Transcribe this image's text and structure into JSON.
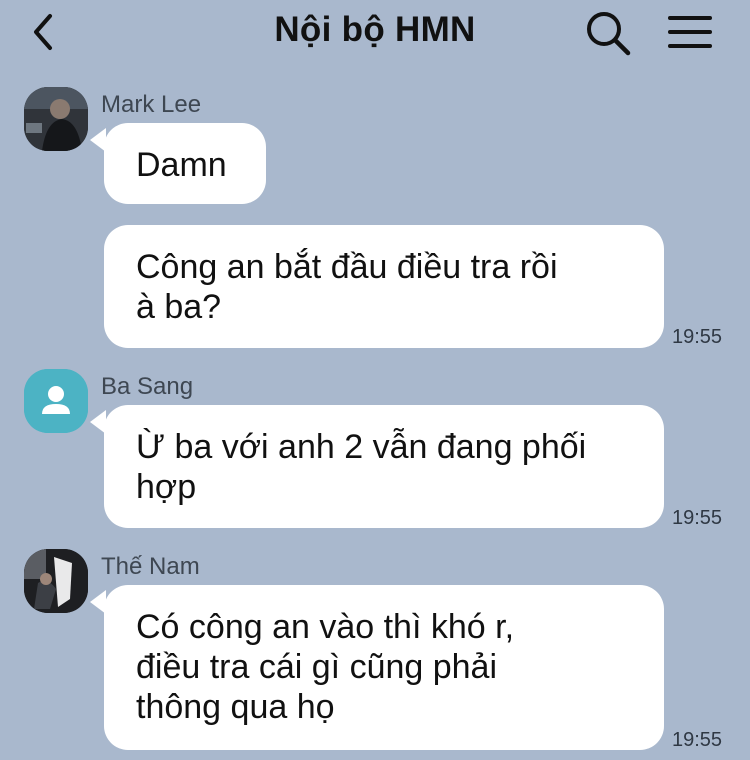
{
  "header": {
    "title": "Nội bộ HMN",
    "back_icon": "chevron-left-icon",
    "search_icon": "search-icon",
    "menu_icon": "hamburger-menu-icon"
  },
  "messages": [
    {
      "sender": "Mark Lee",
      "avatar": "photo-avatar",
      "bubbles": [
        {
          "text": "Damn",
          "time": ""
        },
        {
          "text": "Công an bắt đầu điều tra rồi\nà ba?",
          "time": "19:55"
        }
      ]
    },
    {
      "sender": "Ba Sang",
      "avatar": "default-user-avatar",
      "avatar_color": "#4cb3c4",
      "bubbles": [
        {
          "text": "Ừ ba với anh 2 vẫn đang phối\nhợp",
          "time": "19:55"
        }
      ]
    },
    {
      "sender": "Thế Nam",
      "avatar": "photo-avatar",
      "bubbles": [
        {
          "text": "Có công an vào thì khó r,\nđiều tra cái gì cũng phải\nthông qua họ",
          "time": "19:55"
        }
      ]
    }
  ],
  "colors": {
    "background": "#a9b8cd",
    "bubble": "#ffffff"
  }
}
